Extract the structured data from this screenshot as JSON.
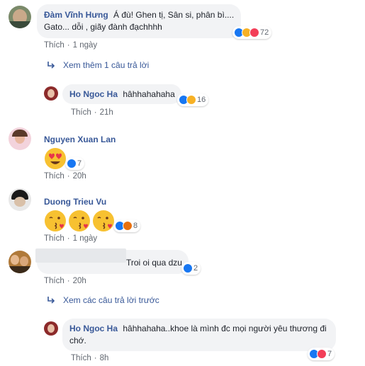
{
  "comments": [
    {
      "name": "Đàm Vĩnh Hưng",
      "text_line1": "Á đù! Ghen tị, Sân si, phân bì....",
      "text_line2": "Gato... dỗi , giãy đành đạchhhh",
      "reaction_count": "72",
      "like_label": "Thích",
      "time": "1 ngày"
    },
    {
      "name": "Ho Ngoc Ha",
      "text": "hâhhahahaha",
      "reaction_count": "16",
      "like_label": "Thích",
      "time": "21h"
    },
    {
      "name": "Nguyen Xuan Lan",
      "reaction_count": "7",
      "like_label": "Thích",
      "time": "20h"
    },
    {
      "name": "Duong Trieu Vu",
      "reaction_count": "8",
      "like_label": "Thích",
      "time": "1 ngày"
    },
    {
      "text": "Troi oi qua dzu",
      "reaction_count": "2",
      "like_label": "Thích",
      "time": "20h"
    },
    {
      "name": "Ho Ngoc Ha",
      "text_line1": "hâhhahaha..khoe là mình đc mọi người yêu thương đi",
      "text_line2": "chớ.",
      "reaction_count": "7",
      "like_label": "Thích",
      "time": "8h"
    }
  ],
  "links": {
    "more_replies": "Xem thêm 1 câu trả lời",
    "previous_replies": "Xem các câu trả lời trước"
  },
  "colors": {
    "name_blue": "#385898",
    "bubble_gray": "#f2f3f5",
    "like_blue": "#1877f2",
    "love_red": "#f33e58",
    "haha_yellow": "#f7b125"
  }
}
